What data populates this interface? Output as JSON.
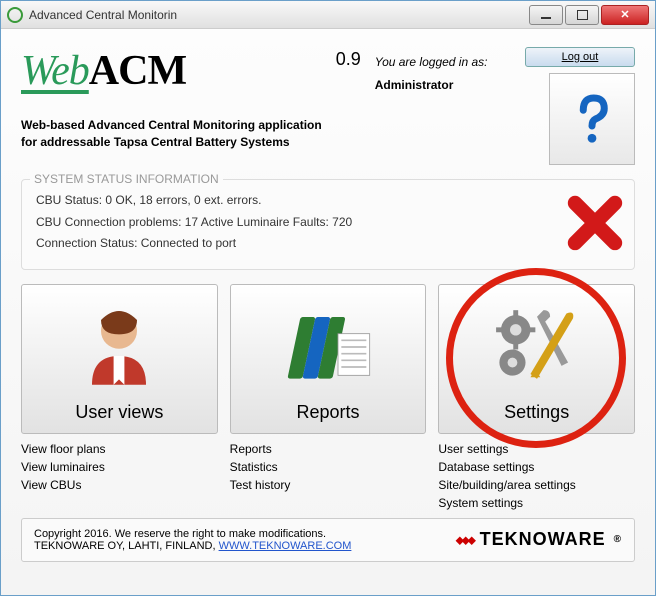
{
  "window": {
    "title": "Advanced Central Monitorin"
  },
  "logo": {
    "web": "Web",
    "acm": "ACM",
    "version": "0.9"
  },
  "login": {
    "prefix": "You are logged in as:",
    "user": "Administrator"
  },
  "logout_label": "Log out",
  "tagline1": "Web-based Advanced Central Monitoring application",
  "tagline2": "for addressable Tapsa Central Battery Systems",
  "status": {
    "title": "SYSTEM STATUS INFORMATION",
    "line1": "CBU Status:  0 OK,   18 errors,  0   ext. errors.",
    "line2": "CBU Connection problems:  17     Active Luminaire Faults:   720",
    "line3": "Connection Status:    Connected to port"
  },
  "cols": {
    "userviews": {
      "label": "User views",
      "links": [
        "View floor plans",
        "View luminaires",
        "View CBUs"
      ]
    },
    "reports": {
      "label": "Reports",
      "links": [
        "Reports",
        "Statistics",
        "Test history"
      ]
    },
    "settings": {
      "label": "Settings",
      "links": [
        "User settings",
        "Database settings",
        "Site/building/area settings",
        "System settings"
      ]
    }
  },
  "footer": {
    "line1": "Copyright 2016. We reserve the right to make modifications.",
    "line2_prefix": "TEKNOWARE OY, LAHTI, FINLAND, ",
    "url": "WWW.TEKNOWARE.COM",
    "brand": "TEKNOWARE"
  }
}
